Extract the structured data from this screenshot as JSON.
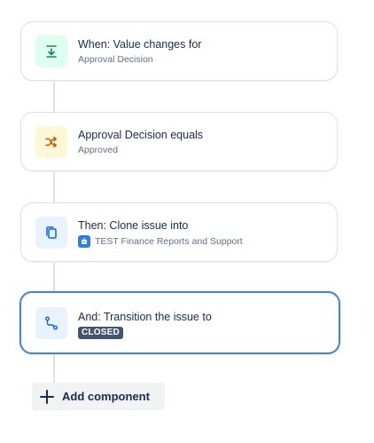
{
  "rule": {
    "components": [
      {
        "kind": "trigger",
        "icon": "field-value-changed-icon",
        "title": "When: Value changes for",
        "subtitle": "Approval Decision"
      },
      {
        "kind": "condition",
        "icon": "shuffle-condition-icon",
        "title": "Approval Decision equals",
        "subtitle": "Approved"
      },
      {
        "kind": "action",
        "icon": "clone-issue-icon",
        "title": "Then: Clone issue into",
        "subtitle": "TEST Finance Reports and Support",
        "subtitle_icon": "project-avatar-icon"
      },
      {
        "kind": "action",
        "icon": "transition-issue-icon",
        "title": "And: Transition the issue to",
        "status": "CLOSED",
        "selected": true
      }
    ],
    "add_button": {
      "label": "Add component",
      "icon": "plus-icon"
    }
  },
  "colors": {
    "trigger_bg": "#dcfff1",
    "trigger_fg": "#1f845a",
    "condition_bg": "#fff7d6",
    "condition_fg": "#b65c02",
    "action_bg": "#e9f2ff",
    "action_fg": "#0c66e4",
    "selected_border": "#4c84c9",
    "status_lozenge": "#44546f"
  }
}
